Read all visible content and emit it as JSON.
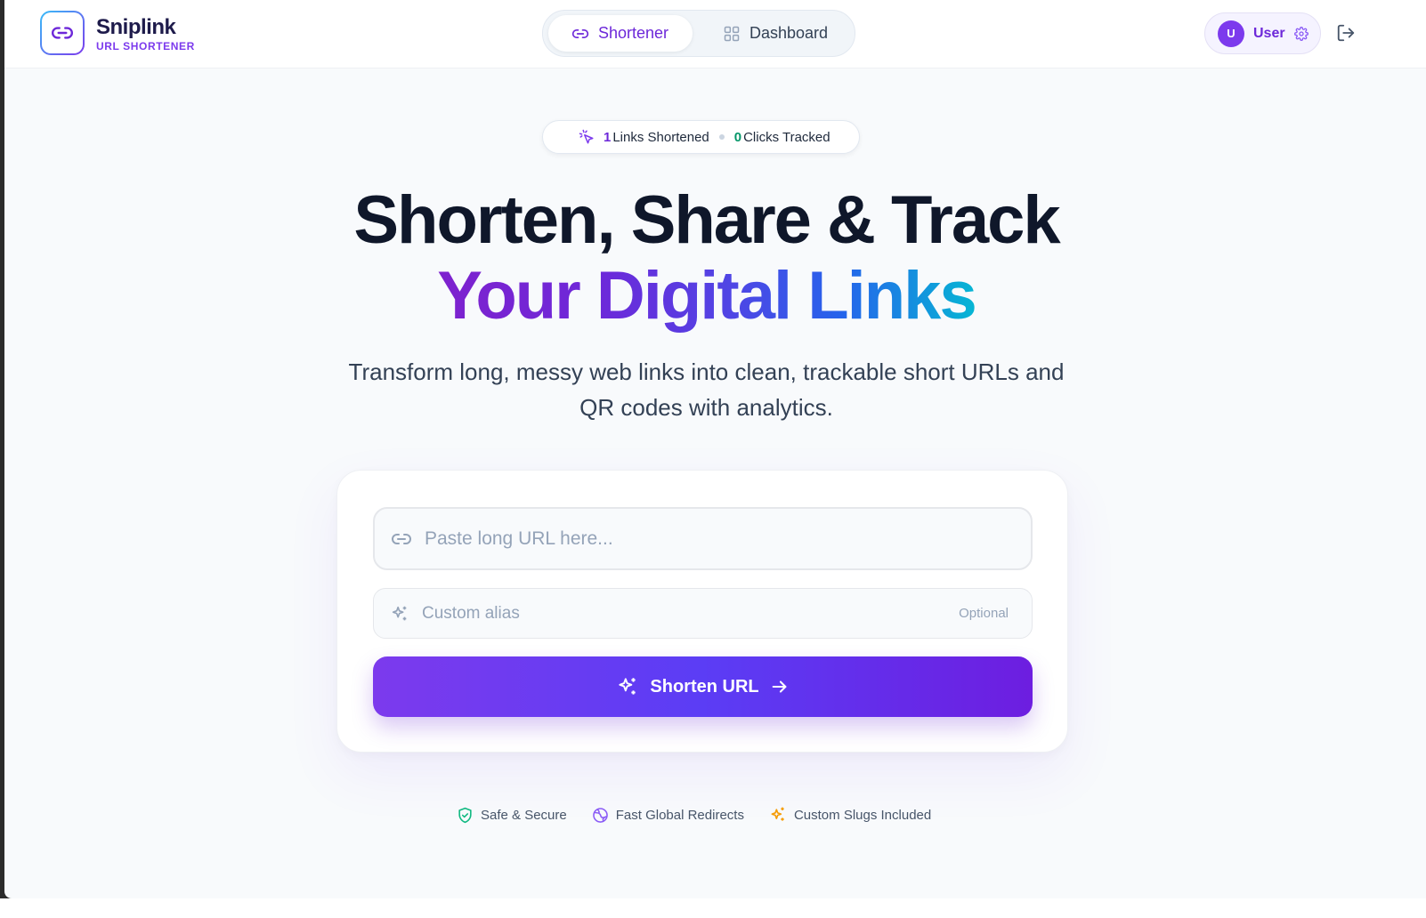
{
  "brand": {
    "name": "Sniplink",
    "subtitle": "URL SHORTENER"
  },
  "nav": {
    "tabs": [
      {
        "label": "Shortener",
        "active": true,
        "icon": "link-icon"
      },
      {
        "label": "Dashboard",
        "active": false,
        "icon": "grid-icon"
      }
    ]
  },
  "user": {
    "avatar_initial": "U",
    "name": "User",
    "settings_icon": "gear-icon",
    "logout_icon": "logout-icon"
  },
  "stats": {
    "links_count": "1",
    "links_label": "Links Shortened",
    "clicks_count": "0",
    "clicks_label": "Clicks Tracked"
  },
  "hero": {
    "line1": "Shorten, Share & Track",
    "line2": "Your Digital Links",
    "tagline": "Transform long, messy web links into clean, trackable short URLs and QR codes with analytics."
  },
  "form": {
    "url_placeholder": "Paste long URL here...",
    "alias_placeholder": "Custom alias",
    "alias_optional": "Optional",
    "submit_label": "Shorten URL"
  },
  "features": [
    {
      "label": "Safe & Secure",
      "icon": "shield-check-icon",
      "color": "#10b981"
    },
    {
      "label": "Fast Global Redirects",
      "icon": "globe-icon",
      "color": "#8b5cf6"
    },
    {
      "label": "Custom Slugs Included",
      "icon": "sparkles-icon",
      "color": "#f59e0b"
    }
  ],
  "colors": {
    "accent": "#7c3aed",
    "accent_dark": "#6d28d9",
    "green": "#059669",
    "background": "#f8fafc"
  }
}
